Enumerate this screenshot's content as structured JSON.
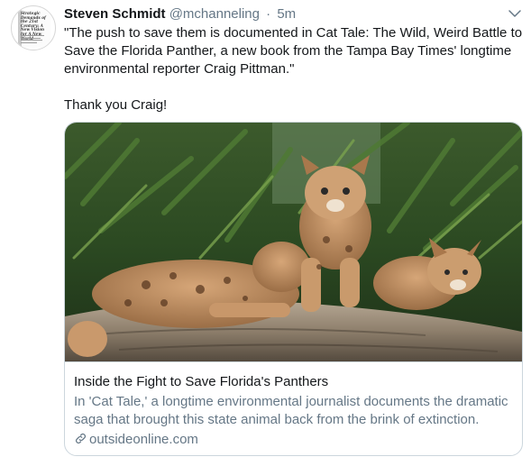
{
  "tweet": {
    "author_name": "Steven Schmidt",
    "author_handle": "@mchanneling",
    "separator": "·",
    "time": "5m",
    "avatar": {
      "book_title": "Strategic Demands of the 21st Century: A New Vision for A New World"
    },
    "text_line_1": "\"The push to save them is documented in Cat Tale: The Wild, Weird Battle to Save the Florida Panther, a new book from the Tampa Bay Times' longtime environmental reporter Craig Pittman.\"",
    "text_line_2": "Thank you Craig!"
  },
  "card": {
    "image_alt": "Florida panther kittens on a log",
    "title": "Inside the Fight to Save Florida's Panthers",
    "description": "In 'Cat Tale,' a longtime environmental journalist documents the dramatic saga that brought this state animal back from the brink of extinction.",
    "domain": "outsideonline.com"
  },
  "icons": {
    "menu": "chevron-down-icon",
    "link": "link-icon"
  },
  "colors": {
    "text_primary": "#14171a",
    "text_secondary": "#657786",
    "border": "#ccd6dd"
  }
}
